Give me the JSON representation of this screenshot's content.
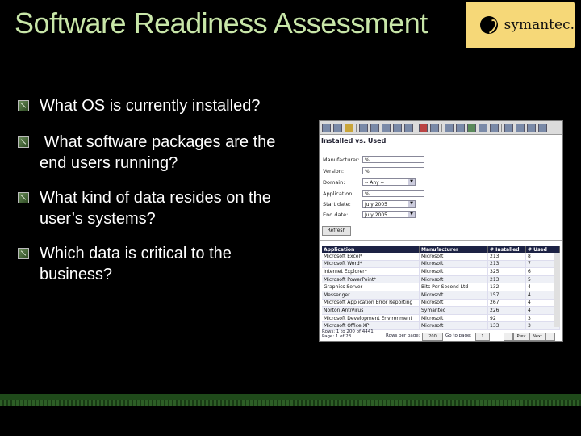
{
  "slide": {
    "title": "Software Readiness Assessment",
    "logo_text": "symantec.",
    "bullets": [
      "What OS is currently installed?",
      " What software packages are the end users running?",
      "What kind of data resides on the user’s systems?",
      "Which data is critical to the business?"
    ],
    "colors": {
      "title": "#c8e6a8",
      "background": "#000000",
      "logo_bg": "#f6d878",
      "band": "#1f4a1a"
    }
  },
  "screenshot": {
    "section_title": "Installed vs. Used",
    "filters": {
      "manufacturer_label": "Manufacturer:",
      "manufacturer_value": "%",
      "version_label": "Version:",
      "version_value": "%",
      "domain_label": "Domain:",
      "domain_value": "-- Any --",
      "application_label": "Application:",
      "application_value": "%",
      "start_label": "Start date:",
      "start_value": "July 2005",
      "end_label": "End date:",
      "end_value": "July 2005"
    },
    "refresh_label": "Refresh",
    "table": {
      "headers": [
        "Application",
        "Manufacturer",
        "# Installed",
        "# Used"
      ],
      "rows": [
        [
          "Microsoft Excel*",
          "Microsoft",
          "213",
          "8"
        ],
        [
          "Microsoft Word*",
          "Microsoft",
          "213",
          "7"
        ],
        [
          "Internet Explorer*",
          "Microsoft",
          "325",
          "6"
        ],
        [
          "Microsoft PowerPoint*",
          "Microsoft",
          "213",
          "5"
        ],
        [
          "Graphics Server",
          "Bits Per Second Ltd",
          "132",
          "4"
        ],
        [
          "Messenger",
          "Microsoft",
          "157",
          "4"
        ],
        [
          "Microsoft Application Error Reporting",
          "Microsoft",
          "267",
          "4"
        ],
        [
          "Norton AntiVirus",
          "Symantec",
          "226",
          "4"
        ],
        [
          "Microsoft Development Environment",
          "Microsoft",
          "92",
          "3"
        ],
        [
          "Microsoft Office XP",
          "Microsoft",
          "133",
          "3"
        ]
      ]
    },
    "footer": {
      "rows_text": "Rows: 1 to 200 of 4441",
      "pages_text": "Page: 1 of 23",
      "rows_per_page_label": "Rows per page:",
      "rows_per_page_value": "200",
      "goto_label": "Go to page:",
      "goto_value": "1",
      "prev_label": "Prev",
      "next_label": "Next"
    }
  }
}
